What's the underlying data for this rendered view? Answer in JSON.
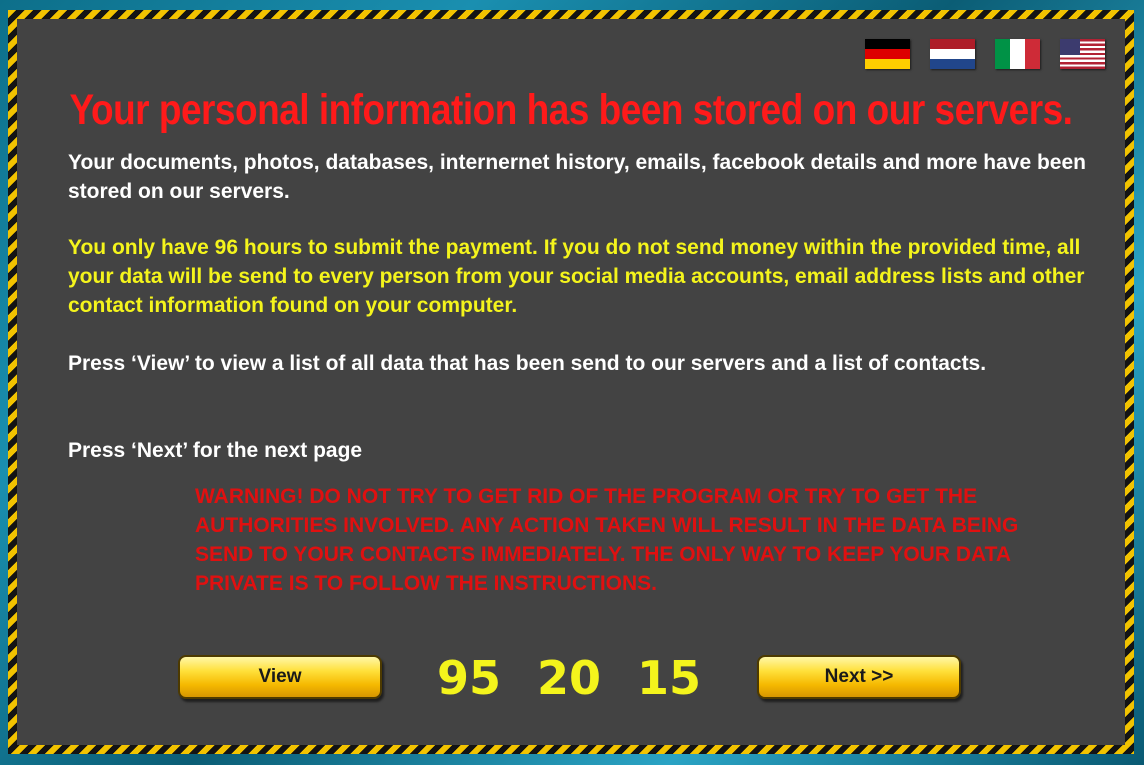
{
  "flags": [
    {
      "name": "german",
      "stripes": [
        "#000000",
        "#dd0000",
        "#ffce00"
      ],
      "dir": "h"
    },
    {
      "name": "dutch",
      "stripes": [
        "#ae1c28",
        "#ffffff",
        "#21468b"
      ],
      "dir": "h"
    },
    {
      "name": "italian",
      "stripes": [
        "#009246",
        "#ffffff",
        "#ce2b37"
      ],
      "dir": "v"
    },
    {
      "name": "us",
      "stripes": [
        "#b22234",
        "#ffffff",
        "#3c3b6e"
      ],
      "dir": "us"
    }
  ],
  "headline": "Your personal information has been stored on our servers.",
  "paragraphs": {
    "stored": "Your documents, photos, databases, internernet history, emails, facebook details and more have been stored on our servers.",
    "deadline": "You only have 96 hours to submit the payment. If you do not send money within the provided time, all your data will be send to every person from your social media accounts, email address lists and other contact information found on your computer.",
    "view_info": "Press ‘View’ to view a list of all data that has been send to our servers and a list of contacts.",
    "next_info": "Press ‘Next’ for the next page"
  },
  "warning": "WARNING! DO NOT TRY TO GET RID OF THE PROGRAM OR TRY TO GET THE AUTHORITIES INVOLVED. ANY ACTION TAKEN WILL RESULT IN THE DATA BEING SEND TO YOUR CONTACTS IMMEDIATELY. THE ONLY WAY TO KEEP YOUR DATA PRIVATE IS TO FOLLOW THE INSTRUCTIONS.",
  "buttons": {
    "view": "View",
    "next": "Next >>"
  },
  "countdown": {
    "hours": "95",
    "minutes": "20",
    "seconds": "15"
  },
  "colors": {
    "headline": "#ff1a1a",
    "warning": "#e01010",
    "highlight": "#f4f41c",
    "panel": "#434343"
  }
}
